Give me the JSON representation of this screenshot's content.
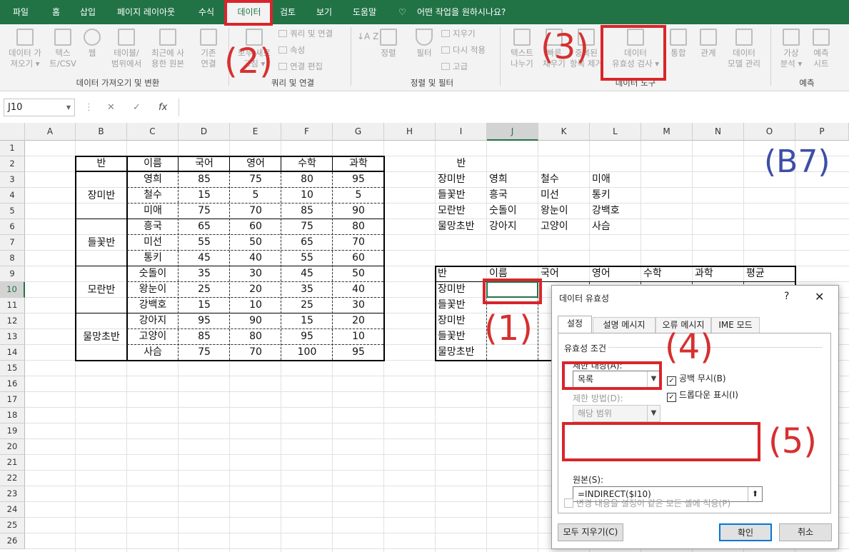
{
  "menu": {
    "tabs": [
      "파일",
      "홈",
      "삽입",
      "페이지 레이아웃",
      "수식",
      "데이터",
      "검토",
      "보기",
      "도움말"
    ],
    "tellme": "어떤 작업을 원하시나요?"
  },
  "ribbon": {
    "get_data": {
      "btn1": "데이터 가\n져오기 ▾",
      "btn2": "텍스\n트/CSV",
      "btn3": "웹",
      "btn4": "테이블/\n범위에서",
      "btn5": "최근에 사\n용한 원본",
      "btn6": "기존\n연결",
      "label": "데이터 가져오기 및 변환"
    },
    "queries": {
      "refresh": "모두 새로\n고침 ▾",
      "item1": "쿼리 및 연결",
      "item2": "속성",
      "item3": "연결 편집",
      "label": "쿼리 및 연결"
    },
    "sort": {
      "az": "↓A Z",
      "sort": "정렬",
      "filter": "필터",
      "clear": "지우기",
      "reapply": "다시 적용",
      "advanced": "고급",
      "label": "정렬 및 필터"
    },
    "tools": {
      "text_to_col": "텍스트\n나누기",
      "flash": "빠른\n채우기",
      "remove_dup": "중복된\n항목 제거",
      "validation": "데이터\n유효성 검사 ▾",
      "consolidate": "통합",
      "relations": "관계",
      "model": "데이터\n모델 관리",
      "label": "데이터 도구"
    },
    "forecast": {
      "whatif": "가상\n분석 ▾",
      "sheet": "예측\n시트",
      "label": "예측"
    }
  },
  "formula_bar": {
    "name_box": "J10",
    "fx": "fx",
    "cancel": "✕",
    "enter": "✓"
  },
  "columns": [
    "A",
    "B",
    "C",
    "D",
    "E",
    "F",
    "G",
    "H",
    "I",
    "J",
    "K",
    "L",
    "M",
    "N",
    "O",
    "P"
  ],
  "rows": [
    "1",
    "2",
    "3",
    "4",
    "5",
    "6",
    "7",
    "8",
    "9",
    "10",
    "11",
    "12",
    "13",
    "14",
    "15",
    "16",
    "17",
    "18",
    "19",
    "20",
    "21",
    "22",
    "23",
    "24",
    "25",
    "26"
  ],
  "table1": {
    "headers": [
      "반",
      "이름",
      "국어",
      "영어",
      "수학",
      "과학"
    ],
    "groups": [
      "장미반",
      "들꽃반",
      "모란반",
      "물망초반"
    ],
    "rows": [
      [
        "영희",
        "85",
        "75",
        "80",
        "95"
      ],
      [
        "철수",
        "15",
        "5",
        "10",
        "5"
      ],
      [
        "미애",
        "75",
        "70",
        "85",
        "90"
      ],
      [
        "흥국",
        "65",
        "60",
        "75",
        "80"
      ],
      [
        "미선",
        "55",
        "50",
        "65",
        "70"
      ],
      [
        "통키",
        "45",
        "40",
        "55",
        "60"
      ],
      [
        "숫돌이",
        "35",
        "30",
        "45",
        "50"
      ],
      [
        "왕눈이",
        "25",
        "20",
        "35",
        "40"
      ],
      [
        "강백호",
        "15",
        "10",
        "25",
        "30"
      ],
      [
        "강아지",
        "95",
        "90",
        "15",
        "20"
      ],
      [
        "고양이",
        "85",
        "80",
        "95",
        "10"
      ],
      [
        "사슴",
        "75",
        "70",
        "100",
        "95"
      ]
    ]
  },
  "table2": {
    "header": "반",
    "rows": [
      [
        "장미반",
        "영희",
        "철수",
        "미애"
      ],
      [
        "들꽃반",
        "흥국",
        "미선",
        "통키"
      ],
      [
        "모란반",
        "숫돌이",
        "왕눈이",
        "강백호"
      ],
      [
        "물망초반",
        "강아지",
        "고양이",
        "사슴"
      ]
    ]
  },
  "table3": {
    "headers": [
      "반",
      "이름",
      "국어",
      "영어",
      "수학",
      "과학",
      "평균"
    ],
    "col_i": [
      "장미반",
      "들꽃반",
      "장미반",
      "들꽃반",
      "물망초반"
    ]
  },
  "annotations": {
    "a1": "(1)",
    "a2": "(2)",
    "a3": "(3)",
    "a4": "(4)",
    "a5": "(5)",
    "b7": "(B7)"
  },
  "dialog": {
    "title": "데이터 유효성",
    "help": "?",
    "close": "✕",
    "tabs": [
      "설정",
      "설명 메시지",
      "오류 메시지",
      "IME 모드"
    ],
    "criteria": "유효성 조건",
    "allow_label": "제한 대상(A):",
    "allow_value": "목록",
    "ignore_blank": "공백 무시(B)",
    "dropdown": "드롭다운 표시(I)",
    "data_label": "제한 방법(D):",
    "data_value": "해당 범위",
    "source_label": "원본(S):",
    "source_value": "=INDIRECT($I10)",
    "apply_all": "변경 내용을 설정이 같은 모든 셀에 적용(P)",
    "clear_all": "모두 지우기(C)",
    "ok": "확인",
    "cancel": "취소"
  }
}
